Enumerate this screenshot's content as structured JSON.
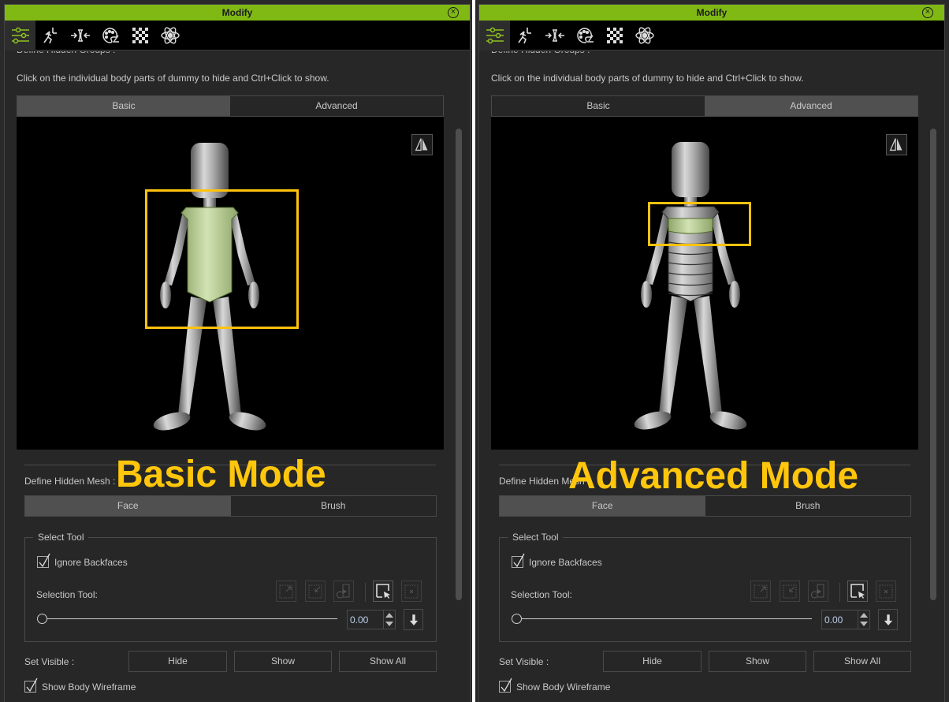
{
  "panels": [
    {
      "id": "left",
      "title": "Modify",
      "toolbar_icons": [
        "sliders-icon",
        "running-figure-icon",
        "squeeze-icon",
        "palette-icon",
        "checker-icon",
        "atom-icon"
      ],
      "cutoff_heading": "Define Hidden Groups :",
      "instruction": "Click on the individual body parts of dummy to hide and Ctrl+Click to show.",
      "mode_tabs": [
        {
          "label": "Basic",
          "active": true
        },
        {
          "label": "Advanced",
          "active": false
        }
      ],
      "overlay_label": "Basic Mode",
      "define_hidden_mesh_label": "Define Hidden Mesh :",
      "mesh_tabs": [
        {
          "label": "Face",
          "active": true
        },
        {
          "label": "Brush",
          "active": false
        }
      ],
      "select_tool": {
        "title": "Select Tool",
        "ignore_backfaces_label": "Ignore Backfaces",
        "ignore_backfaces_checked": true,
        "selection_tool_label": "Selection Tool:",
        "value": "0.00"
      },
      "set_visible_label": "Set Visible :",
      "buttons": {
        "hide": "Hide",
        "show": "Show",
        "show_all": "Show All"
      },
      "show_body_wireframe_label": "Show Body Wireframe",
      "show_body_wireframe_checked": true
    },
    {
      "id": "right",
      "title": "Modify",
      "toolbar_icons": [
        "sliders-icon",
        "running-figure-icon",
        "squeeze-icon",
        "palette-icon",
        "checker-icon",
        "atom-icon"
      ],
      "cutoff_heading": "Define Hidden Groups :",
      "instruction": "Click on the individual body parts of dummy to hide and Ctrl+Click to show.",
      "mode_tabs": [
        {
          "label": "Basic",
          "active": false
        },
        {
          "label": "Advanced",
          "active": true
        }
      ],
      "overlay_label": "Advanced Mode",
      "define_hidden_mesh_label": "Define Hidden Mesh :",
      "mesh_tabs": [
        {
          "label": "Face",
          "active": true
        },
        {
          "label": "Brush",
          "active": false
        }
      ],
      "select_tool": {
        "title": "Select Tool",
        "ignore_backfaces_label": "Ignore Backfaces",
        "ignore_backfaces_checked": true,
        "selection_tool_label": "Selection Tool:",
        "value": "0.00"
      },
      "set_visible_label": "Set Visible :",
      "buttons": {
        "hide": "Hide",
        "show": "Show",
        "show_all": "Show All"
      },
      "show_body_wireframe_label": "Show Body Wireframe",
      "show_body_wireframe_checked": true
    }
  ],
  "colors": {
    "title_bar": "#80b914",
    "accent_icon": "#8fc31f",
    "highlight_box": "#ffc20e",
    "selected_mesh": "#b8d08c"
  }
}
